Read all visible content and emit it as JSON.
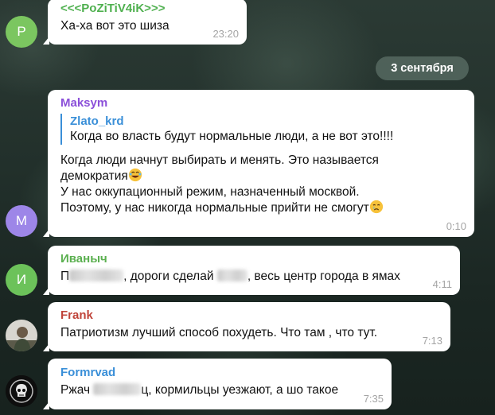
{
  "messages": [
    {
      "sender": "<<<PoZiTiV4iK>>>",
      "sender_color": "#4fb04f",
      "avatar_letter": "P",
      "avatar_color": "#7bc660",
      "text": "Ха-ха вот это шиза",
      "time": "23:20"
    },
    {
      "sender": "Maksym",
      "sender_color": "#8b4fd9",
      "avatar_letter": "M",
      "avatar_color": "#9d86e8",
      "reply_name": "Zlato_krd",
      "reply_text": "Когда во власть будут нормальные люди, а не вот это!!!!",
      "text_line1": "Когда люди начнут выбирать и менять. Это называется",
      "text_line2": "демократия",
      "text_line3": "У нас оккупационный режим, назначенный москвой.",
      "text_line4": "Поэтому, у нас никогда нормальные прийти не смогут",
      "time": "0:10"
    },
    {
      "sender": "Иваныч",
      "sender_color": "#5bb050",
      "avatar_letter": "И",
      "avatar_color": "#6cc25a",
      "text_a": "П",
      "text_b": ", дороги сделай",
      "text_c": ", весь центр города в ямах",
      "time": "4:11"
    },
    {
      "sender": "Frank",
      "sender_color": "#c0443a",
      "text": "Патриотизм лучший способ похудеть. Что там , что тут.",
      "time": "7:13"
    },
    {
      "sender": "Formrvad",
      "sender_color": "#3a8fd8",
      "text_a": "Ржач",
      "text_b": "ц, кормильцы уезжают, а шо такое",
      "time": "7:35"
    }
  ],
  "date_separator": "3 сентября",
  "icons": {
    "laugh": "laughing-face-emoji",
    "cry": "crying-face-emoji"
  }
}
